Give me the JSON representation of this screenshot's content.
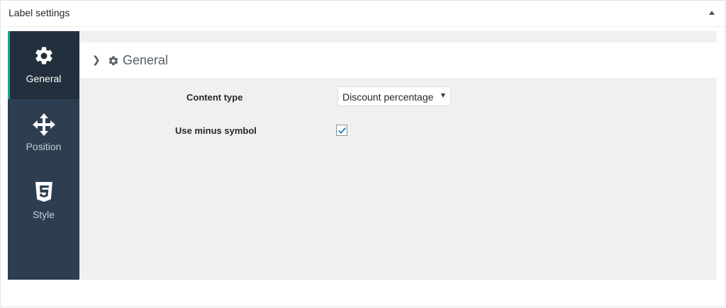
{
  "panel": {
    "title": "Label settings",
    "toggle_icon": "triangle-up-icon"
  },
  "sidebar": {
    "items": [
      {
        "label": "General",
        "icon": "gear-icon",
        "active": true
      },
      {
        "label": "Position",
        "icon": "move-arrows-icon",
        "active": false
      },
      {
        "label": "Style",
        "icon": "css3-icon",
        "active": false
      }
    ]
  },
  "section": {
    "title": "General",
    "expand_icon": "chevron-right-icon",
    "icon": "gear-icon"
  },
  "fields": {
    "content_type_label": "Content type",
    "content_type_value": "Discount percentage",
    "minus_symbol_label": "Use minus symbol",
    "minus_symbol_checked": true
  },
  "colors": {
    "sidebar_bg": "#2c3e50",
    "sidebar_active_bg": "#232f3d",
    "active_accent": "#1fa39a",
    "content_bg": "#f0f0f0",
    "checkbox_check": "#1e8cbe"
  }
}
